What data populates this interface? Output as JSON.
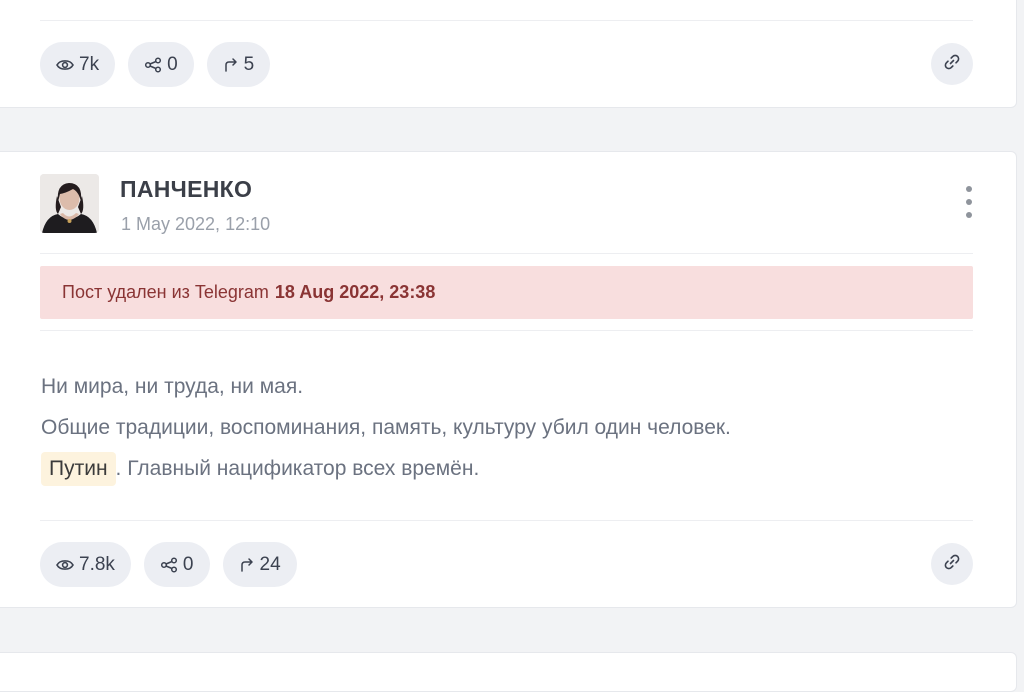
{
  "previous_post": {
    "stats": {
      "views": "7k",
      "shares": "0",
      "forwards": "5"
    }
  },
  "post": {
    "channel_name": "ПАНЧЕНКО",
    "date": "1 May 2022, 12:10",
    "deleted_notice": {
      "text": "Пост удален из Telegram",
      "date": "18 Aug 2022, 23:38"
    },
    "lines": [
      "Ни мира, ни труда, ни мая.",
      "Общие традиции, воспоминания, память, культуру убил один человек."
    ],
    "tag": "Путин",
    "tag_suffix": ". Главный нацификатор всех времён.",
    "stats": {
      "views": "7.8k",
      "shares": "0",
      "forwards": "24"
    }
  },
  "icons": {
    "views": "eye-icon",
    "shares": "share-nodes-icon",
    "forwards": "forward-arrow-icon",
    "link": "link-icon",
    "menu": "more-vertical-icon"
  },
  "colors": {
    "alert_bg": "#f8dede",
    "alert_text": "#8a3434",
    "tag_bg": "#fdf3de",
    "pill_bg": "#eceef3"
  }
}
